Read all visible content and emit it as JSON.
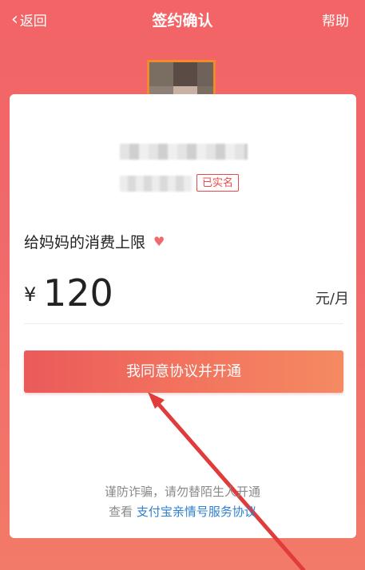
{
  "nav": {
    "back_label": "返回",
    "title": "签约确认",
    "help_label": "帮助"
  },
  "profile": {
    "verified_label": "已实名"
  },
  "limit": {
    "label": "给妈妈的消费上限",
    "currency": "¥",
    "amount": "120",
    "unit": "元/月"
  },
  "actions": {
    "agree_label": "我同意协议并开通"
  },
  "footer": {
    "notice": "谨防诈骗，请勿替陌生人开通",
    "view_prefix": "查看",
    "agreement_link": "支付宝亲情号服务协议"
  },
  "colors": {
    "header_bg": "#f26466",
    "button_start": "#ea5a5a",
    "button_end": "#f48a62",
    "link": "#2f80d1",
    "verified": "#e84a4a",
    "arrow": "#e23b3b"
  },
  "icons": {
    "back": "chevron-left-icon",
    "heart": "heart-icon",
    "arrow": "annotation-arrow"
  }
}
